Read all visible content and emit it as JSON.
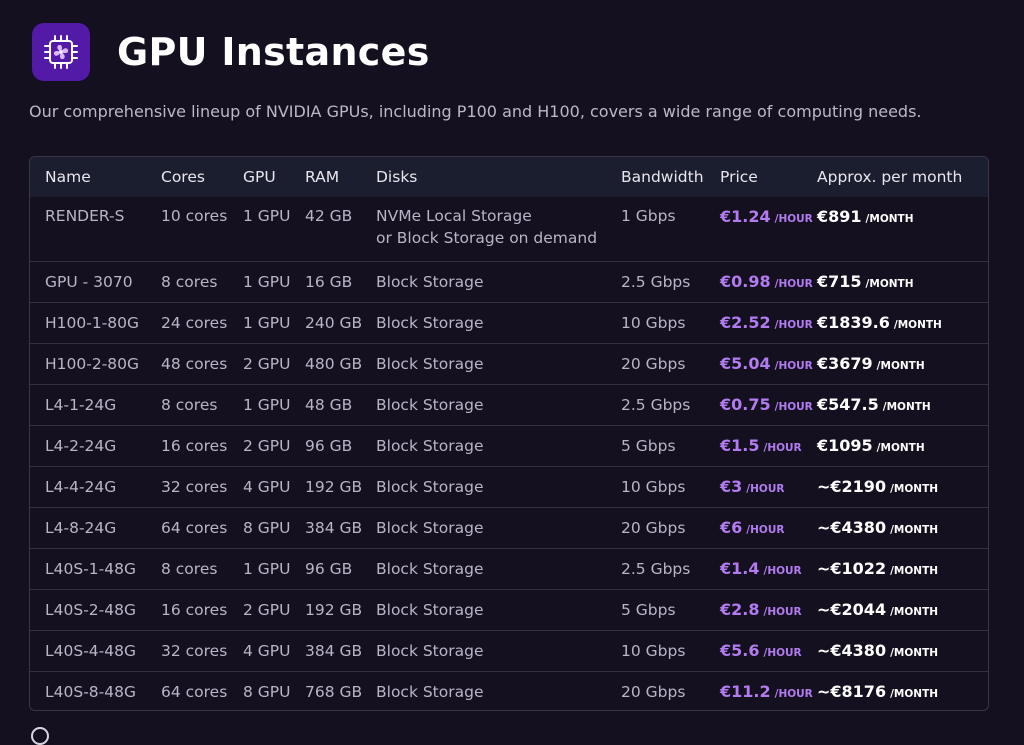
{
  "page": {
    "title": "GPU Instances",
    "subtitle": "Our comprehensive lineup of NVIDIA GPUs, including P100 and H100, covers a wide range of computing needs."
  },
  "colors": {
    "background": "#151020",
    "logo_bg": "#521aa6",
    "price_accent": "#b17cf0",
    "header_row_bg": "#1b1e2e"
  },
  "icons": {
    "logo": "gpu-chip-fan-icon",
    "footer": "circle-icon"
  },
  "table": {
    "headers": [
      "Name",
      "Cores",
      "GPU",
      "RAM",
      "Disks",
      "Bandwidth",
      "Price",
      "Approx. per month"
    ],
    "rows": [
      {
        "name": "RENDER-S",
        "cores": "10 cores",
        "gpu": "1 GPU",
        "ram": "42 GB",
        "disks": "NVMe Local Storage",
        "disks2": "or Block Storage on demand",
        "bandwidth": "1 Gbps",
        "price": "€1.24",
        "price_unit": "/HOUR",
        "month": "€891",
        "month_unit": "/MONTH"
      },
      {
        "name": "GPU - 3070",
        "cores": "8 cores",
        "gpu": "1 GPU",
        "ram": "16 GB",
        "disks": "Block Storage",
        "bandwidth": "2.5 Gbps",
        "price": "€0.98",
        "price_unit": "/HOUR",
        "month": "€715",
        "month_unit": "/MONTH"
      },
      {
        "name": "H100-1-80G",
        "cores": "24 cores",
        "gpu": "1 GPU",
        "ram": "240 GB",
        "disks": "Block Storage",
        "bandwidth": "10 Gbps",
        "price": "€2.52",
        "price_unit": "/HOUR",
        "month": "€1839.6",
        "month_unit": "/MONTH"
      },
      {
        "name": "H100-2-80G",
        "cores": "48 cores",
        "gpu": "2 GPU",
        "ram": "480 GB",
        "disks": "Block Storage",
        "bandwidth": "20 Gbps",
        "price": "€5.04",
        "price_unit": "/HOUR",
        "month": "€3679",
        "month_unit": "/MONTH"
      },
      {
        "name": "L4-1-24G",
        "cores": "8 cores",
        "gpu": "1 GPU",
        "ram": "48 GB",
        "disks": "Block Storage",
        "bandwidth": "2.5 Gbps",
        "price": "€0.75",
        "price_unit": "/HOUR",
        "month": "€547.5",
        "month_unit": "/MONTH"
      },
      {
        "name": "L4-2-24G",
        "cores": "16 cores",
        "gpu": "2 GPU",
        "ram": "96 GB",
        "disks": "Block Storage",
        "bandwidth": "5 Gbps",
        "price": "€1.5",
        "price_unit": "/HOUR",
        "month": "€1095",
        "month_unit": "/MONTH"
      },
      {
        "name": "L4-4-24G",
        "cores": "32 cores",
        "gpu": "4 GPU",
        "ram": "192 GB",
        "disks": "Block Storage",
        "bandwidth": "10 Gbps",
        "price": "€3",
        "price_unit": "/HOUR",
        "month": "~€2190",
        "month_unit": "/MONTH"
      },
      {
        "name": "L4-8-24G",
        "cores": "64 cores",
        "gpu": "8 GPU",
        "ram": "384 GB",
        "disks": "Block Storage",
        "bandwidth": "20 Gbps",
        "price": "€6",
        "price_unit": "/HOUR",
        "month": "~€4380",
        "month_unit": "/MONTH"
      },
      {
        "name": "L40S-1-48G",
        "cores": "8 cores",
        "gpu": "1 GPU",
        "ram": "96 GB",
        "disks": "Block Storage",
        "bandwidth": "2.5 Gbps",
        "price": "€1.4",
        "price_unit": "/HOUR",
        "month": "~€1022",
        "month_unit": "/MONTH"
      },
      {
        "name": "L40S-2-48G",
        "cores": "16 cores",
        "gpu": "2 GPU",
        "ram": "192 GB",
        "disks": "Block Storage",
        "bandwidth": "5 Gbps",
        "price": "€2.8",
        "price_unit": "/HOUR",
        "month": "~€2044",
        "month_unit": "/MONTH"
      },
      {
        "name": "L40S-4-48G",
        "cores": "32 cores",
        "gpu": "4 GPU",
        "ram": "384 GB",
        "disks": "Block Storage",
        "bandwidth": "10 Gbps",
        "price": "€5.6",
        "price_unit": "/HOUR",
        "month": "~€4380",
        "month_unit": "/MONTH"
      },
      {
        "name": "L40S-8-48G",
        "cores": "64 cores",
        "gpu": "8 GPU",
        "ram": "768 GB",
        "disks": "Block Storage",
        "bandwidth": "20 Gbps",
        "price": "€11.2",
        "price_unit": "/HOUR",
        "month": "~€8176",
        "month_unit": "/MONTH"
      }
    ]
  }
}
